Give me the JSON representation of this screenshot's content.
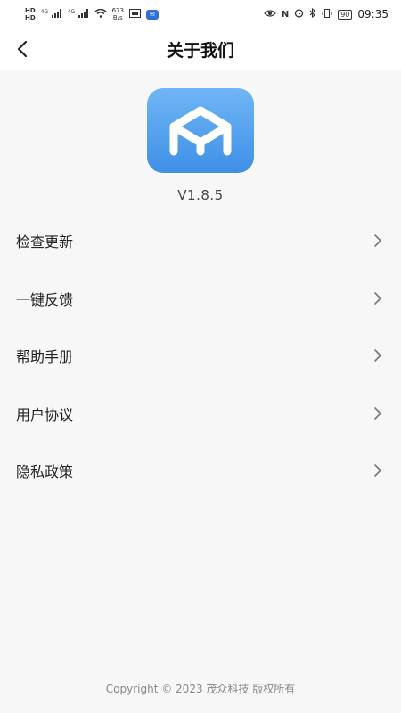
{
  "status_bar": {
    "sim1": "HD",
    "sim2": "HD",
    "signal1": "4G",
    "signal2": "4G",
    "net_speed_value": "673",
    "net_speed_unit": "B/s",
    "nfc_label": "N",
    "battery": "90",
    "time": "09:35"
  },
  "nav": {
    "title": "关于我们"
  },
  "app": {
    "version": "V1.8.5"
  },
  "menu": {
    "items": [
      {
        "label": "检查更新"
      },
      {
        "label": "一键反馈"
      },
      {
        "label": "帮助手册"
      },
      {
        "label": "用户协议"
      },
      {
        "label": "隐私政策"
      }
    ]
  },
  "footer": {
    "copyright": "Copyright © 2023 茂众科技 版权所有"
  },
  "colors": {
    "logo_top": "#6fb6f5",
    "logo_bottom": "#3f8fe6",
    "background": "#f7f7f7"
  }
}
